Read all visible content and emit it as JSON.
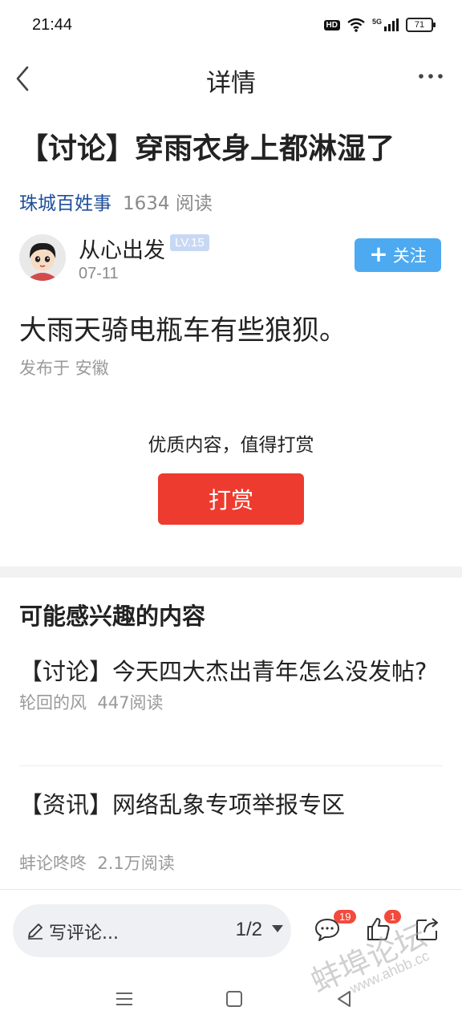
{
  "status_bar": {
    "time": "21:44",
    "hd_label": "HD",
    "network_label": "5G",
    "battery": "71"
  },
  "nav": {
    "title": "详情"
  },
  "article": {
    "title": "【讨论】穿雨衣身上都淋湿了",
    "circle": "珠城百姓事",
    "read_count": "1634 阅读",
    "author": {
      "name": "从心出发",
      "level": "LV.15",
      "date": "07-11"
    },
    "follow_label": "关注",
    "body": "大雨天骑电瓶车有些狼狈。",
    "location": "发布于 安徽"
  },
  "reward": {
    "hint": "优质内容，值得打赏",
    "button_label": "打赏"
  },
  "recommendations": {
    "heading": "可能感兴趣的内容",
    "items": [
      {
        "title": "【讨论】今天四大杰出青年怎么没发帖?",
        "author": "轮回的风",
        "reads": "447阅读"
      },
      {
        "title": "【资讯】网络乱象专项举报专区",
        "author": "蚌论咚咚",
        "reads": "2.1万阅读"
      }
    ]
  },
  "bottom_bar": {
    "comment_placeholder": "写评论...",
    "page": "1/2",
    "comment_count": "19",
    "like_count": "1"
  },
  "watermark": {
    "text": "蚌埠论坛",
    "url": "www.ahbb.cc"
  }
}
